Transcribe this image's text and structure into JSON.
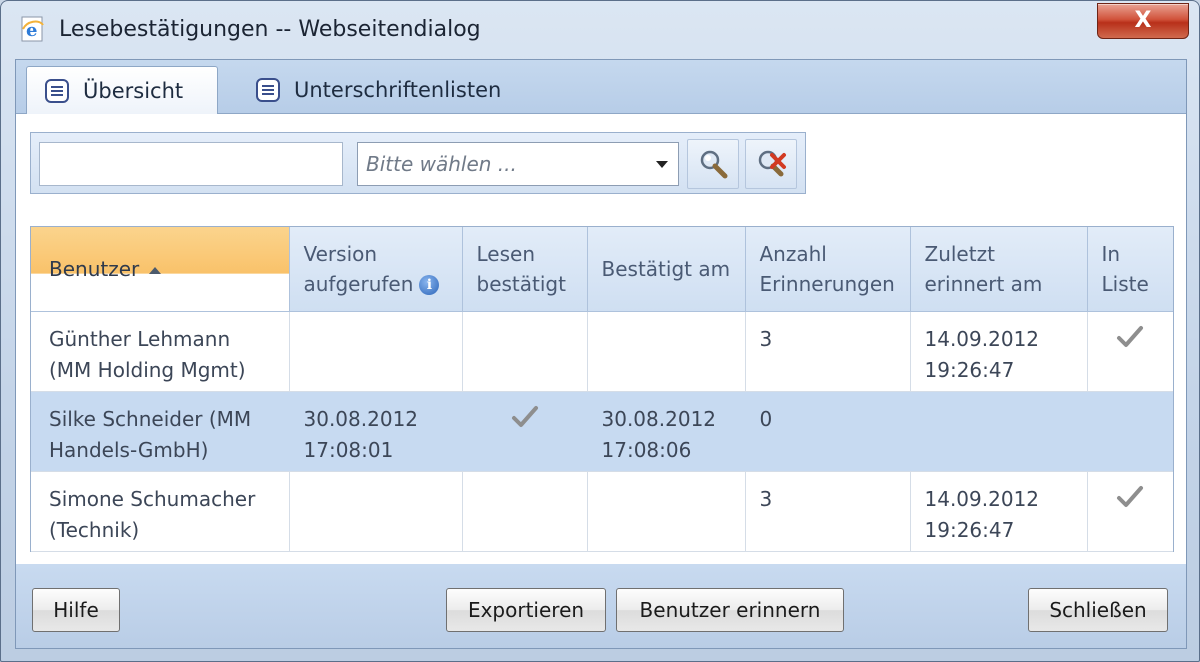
{
  "window": {
    "title": "Lesebestätigungen -- Webseitendialog",
    "close_label": "X"
  },
  "tabs": [
    {
      "label": "Übersicht",
      "active": true
    },
    {
      "label": "Unterschriftenlisten",
      "active": false
    }
  ],
  "filter": {
    "text_value": "",
    "select_value": "Bitte wählen ..."
  },
  "table": {
    "columns": [
      {
        "label": "Benutzer",
        "sorted": "asc"
      },
      {
        "label": "Version aufgerufen",
        "info_icon": true
      },
      {
        "label": "Lesen bestätigt"
      },
      {
        "label": "Bestätigt am"
      },
      {
        "label": "Anzahl Erinnerungen"
      },
      {
        "label": "Zuletzt erinnert am"
      },
      {
        "label": "In Liste"
      }
    ],
    "rows": [
      {
        "benutzer": "Günther Lehmann (MM Holding Mgmt)",
        "version_aufgerufen": "",
        "lesen_bestaetigt": false,
        "bestaetigt_am": "",
        "anzahl_erinnerungen": "3",
        "zuletzt_erinnert_am": "14.09.2012 19:26:47",
        "in_liste": true,
        "selected": false
      },
      {
        "benutzer": "Silke Schneider (MM Handels-GmbH)",
        "version_aufgerufen": "30.08.2012 17:08:01",
        "lesen_bestaetigt": true,
        "bestaetigt_am": "30.08.2012 17:08:06",
        "anzahl_erinnerungen": "0",
        "zuletzt_erinnert_am": "",
        "in_liste": false,
        "selected": true
      },
      {
        "benutzer": "Simone Schumacher (Technik)",
        "version_aufgerufen": "",
        "lesen_bestaetigt": false,
        "bestaetigt_am": "",
        "anzahl_erinnerungen": "3",
        "zuletzt_erinnert_am": "14.09.2012 19:26:47",
        "in_liste": true,
        "selected": false
      }
    ]
  },
  "footer": {
    "help_label": "Hilfe",
    "export_label": "Exportieren",
    "remind_label": "Benutzer erinnern",
    "close_label": "Schließen"
  },
  "icons": {
    "app": "ie-page-icon",
    "tab": "list-icon",
    "search": "search-icon",
    "clear": "clear-search-icon",
    "check": "check-icon",
    "info": "info-icon"
  }
}
